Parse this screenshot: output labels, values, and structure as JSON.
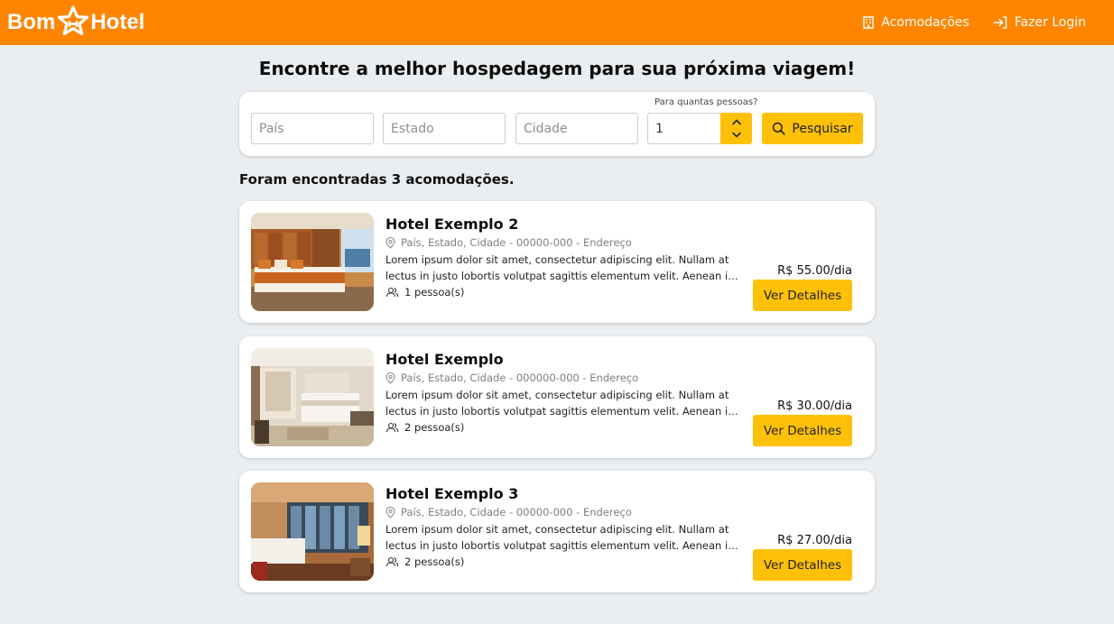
{
  "header": {
    "brand_left": "Bom",
    "brand_right": "Hotel",
    "nav": [
      {
        "label": "Acomodações",
        "icon": "building-icon"
      },
      {
        "label": "Fazer Login",
        "icon": "login-icon"
      }
    ],
    "colors": {
      "background": "#ff8500",
      "text": "#ffffff"
    }
  },
  "page_title": "Encontre a melhor hospedagem para sua próxima viagem!",
  "search": {
    "country_placeholder": "País",
    "state_placeholder": "Estado",
    "city_placeholder": "Cidade",
    "people_label": "Para quantas pessoas?",
    "people_value": "1",
    "search_button_label": "Pesquisar",
    "accent_color": "#ffc107"
  },
  "results": {
    "count_text": "Foram encontradas 3 acomodações.",
    "items": [
      {
        "name": "Hotel Exemplo 2",
        "address": "País, Estado, Cidade - 00000-000 - Endereço",
        "desc_line1": "Lorem ipsum dolor sit amet, consectetur adipiscing elit. Nullam at",
        "desc_line2": "lectus in justo lobortis volutpat sagittis elementum velit. Aenean id...",
        "guests": "1 pessoa(s)",
        "price": "R$ 55.00/dia",
        "button_label": "Ver Detalhes"
      },
      {
        "name": "Hotel Exemplo",
        "address": "País, Estado, Cidade - 000000-000 - Endereço",
        "desc_line1": "Lorem ipsum dolor sit amet, consectetur adipiscing elit. Nullam at",
        "desc_line2": "lectus in justo lobortis volutpat sagittis elementum velit. Aenean id...",
        "guests": "2 pessoa(s)",
        "price": "R$ 30.00/dia",
        "button_label": "Ver Detalhes"
      },
      {
        "name": "Hotel Exemplo 3",
        "address": "País, Estado, Cidade - 00000-000 - Endereço",
        "desc_line1": "Lorem ipsum dolor sit amet, consectetur adipiscing elit. Nullam at",
        "desc_line2": "lectus in justo lobortis volutpat sagittis elementum velit. Aenean id...",
        "guests": "2 pessoa(s)",
        "price": "R$ 27.00/dia",
        "button_label": "Ver Detalhes"
      }
    ]
  }
}
